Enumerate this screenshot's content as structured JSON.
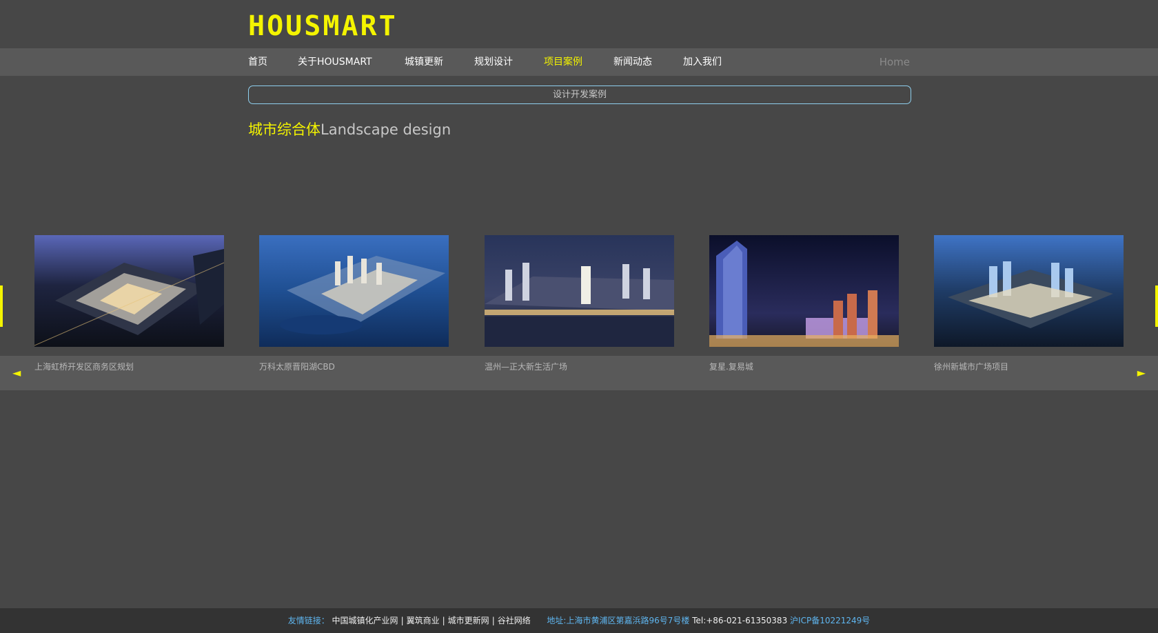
{
  "brand": {
    "logo_text": "HOUSMART",
    "accent": "#f4f400"
  },
  "nav": {
    "items": [
      "首页",
      "关于HOUSMART",
      "城镇更新",
      "规划设计",
      "项目案例",
      "新闻动态",
      "加入我们"
    ],
    "active": "项目案例",
    "home_label": "Home"
  },
  "subtitle": "设计开发案例",
  "section": {
    "title_cn": "城市综合体",
    "title_en": "Landscape design"
  },
  "carousel": {
    "prev_icon": "prev-arrow-icon",
    "next_icon": "next-arrow-icon",
    "items": [
      {
        "caption": "上海虹桥开发区商务区规划"
      },
      {
        "caption": "万科太原晋阳湖CBD"
      },
      {
        "caption": "温州—正大新生活广场"
      },
      {
        "caption": "复星.复易城"
      },
      {
        "caption": "徐州新城市广场项目"
      }
    ]
  },
  "footer": {
    "links_label": "友情链接：",
    "links": [
      "中国城镇化产业网",
      "翼筑商业",
      "城市更新网",
      "谷社网络"
    ],
    "address": "地址:上海市黄浦区第嘉浜路96号7号楼",
    "tel": "Tel:+86-021-61350383",
    "icp": "沪ICP备10221249号"
  }
}
